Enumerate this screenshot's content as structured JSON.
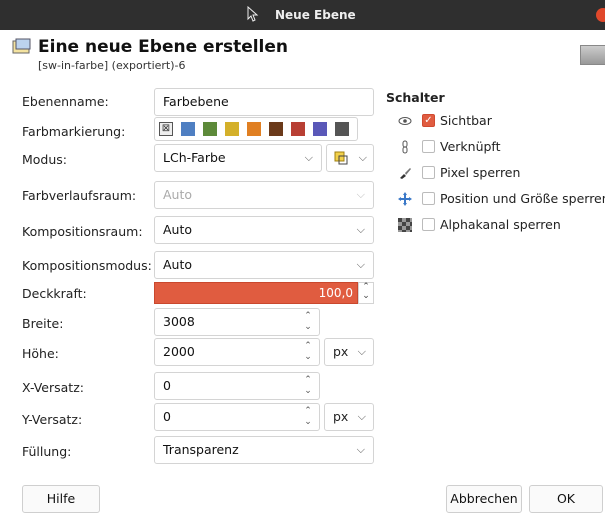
{
  "window": {
    "title": "Neue Ebene"
  },
  "header": {
    "heading": "Eine neue Ebene erstellen",
    "subheading": "[sw-in-farbe] (exportiert)-6"
  },
  "form": {
    "ebenenname": {
      "label": "Ebenenname:",
      "value": "Farbebene"
    },
    "farbmarkierung": {
      "label": "Farbmarkierung:",
      "colors": [
        "none",
        "#4f7fc2",
        "#5d8a3a",
        "#d4b02a",
        "#e07f22",
        "#6b3a1a",
        "#b83f34",
        "#5a58b8",
        "#555555"
      ]
    },
    "modus": {
      "label": "Modus:",
      "value": "LCh-Farbe"
    },
    "farbverlaufsraum": {
      "label": "Farbverlaufsraum:",
      "value": "Auto"
    },
    "kompositionsraum": {
      "label": "Kompositionsraum:",
      "value": "Auto"
    },
    "kompositionsmodus": {
      "label": "Kompositionsmodus:",
      "value": "Auto"
    },
    "deckkraft": {
      "label": "Deckkraft:",
      "value": "100,0"
    },
    "breite": {
      "label": "Breite:",
      "value": "3008"
    },
    "hoehe": {
      "label": "Höhe:",
      "value": "2000",
      "unit": "px"
    },
    "x_versatz": {
      "label": "X-Versatz:",
      "value": "0"
    },
    "y_versatz": {
      "label": "Y-Versatz:",
      "value": "0",
      "unit": "px"
    },
    "fuellung": {
      "label": "Füllung:",
      "value": "Transparenz"
    }
  },
  "schalter": {
    "title": "Schalter",
    "items": [
      {
        "label": "Sichtbar",
        "checked": true,
        "icon": "eye-icon"
      },
      {
        "label": "Verknüpft",
        "checked": false,
        "icon": "chain-icon"
      },
      {
        "label": "Pixel sperren",
        "checked": false,
        "icon": "brush-icon"
      },
      {
        "label": "Position und Größe sperren",
        "checked": false,
        "icon": "move-icon"
      },
      {
        "label": "Alphakanal sperren",
        "checked": false,
        "icon": "checker-icon"
      }
    ]
  },
  "buttons": {
    "help": "Hilfe",
    "cancel": "Abbrechen",
    "ok": "OK"
  }
}
